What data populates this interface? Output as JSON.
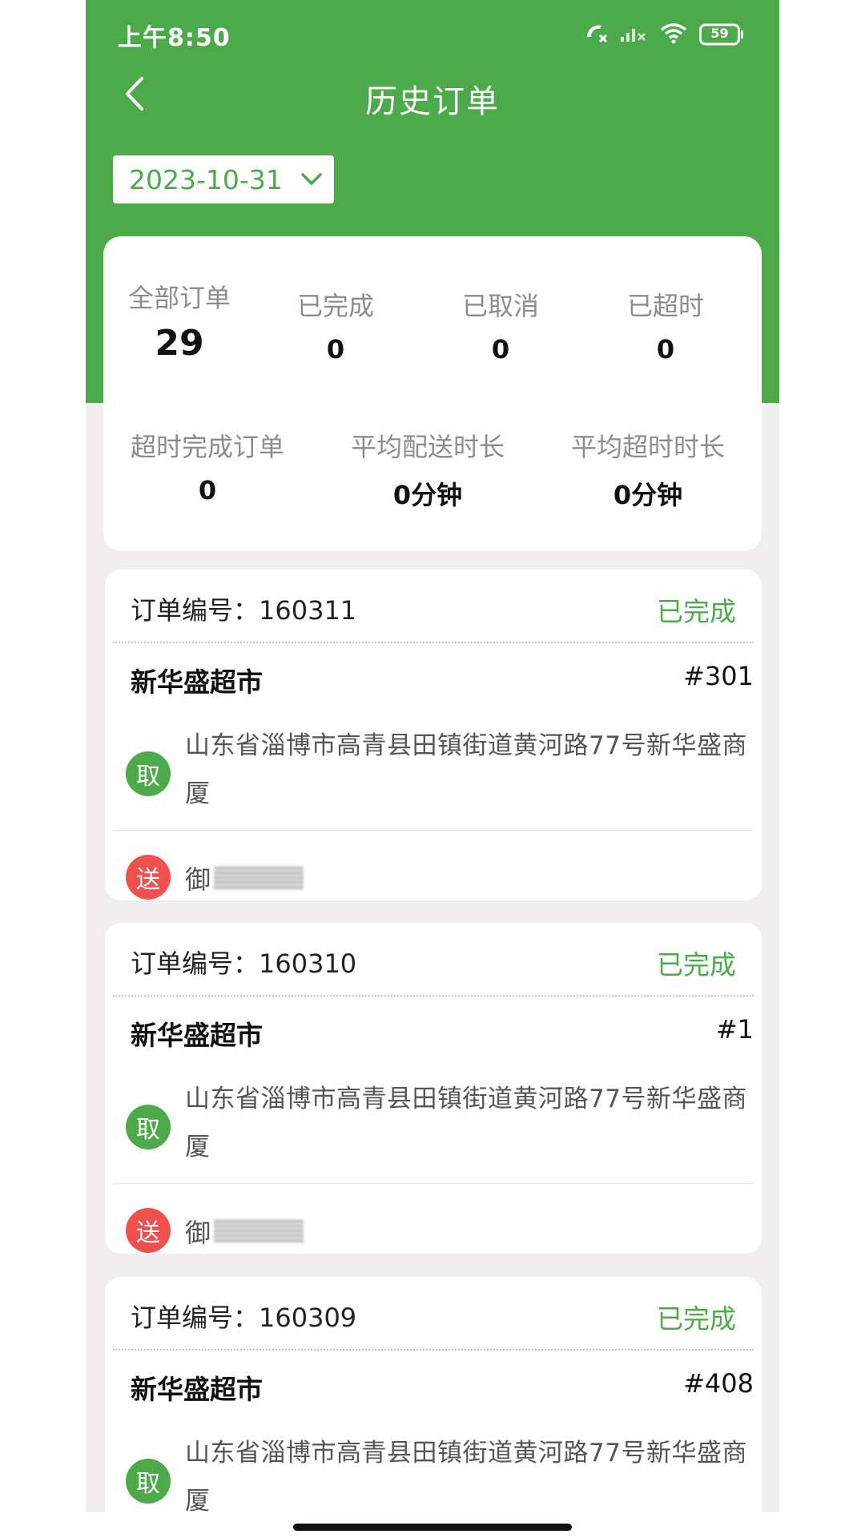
{
  "status_bar": {
    "time": "上午8:50",
    "battery": "59"
  },
  "header": {
    "title": "历史订单",
    "date": "2023-10-31"
  },
  "summary": {
    "row1": [
      {
        "label": "全部订单",
        "value": "29"
      },
      {
        "label": "已完成",
        "value": "0"
      },
      {
        "label": "已取消",
        "value": "0"
      },
      {
        "label": "已超时",
        "value": "0"
      }
    ],
    "row2": [
      {
        "label": "超时完成订单",
        "value": "0"
      },
      {
        "label": "平均配送时长",
        "value": "0分钟"
      },
      {
        "label": "平均超时时长",
        "value": "0分钟"
      }
    ]
  },
  "orders": [
    {
      "number_label": "订单编号：160311",
      "status": "已完成",
      "shop": "新华盛超市",
      "tag": "#301",
      "pickup_badge": "取",
      "pickup_address": "山东省淄博市高青县田镇街道黄河路77号新华盛商厦",
      "deliver_badge": "送",
      "deliver_name": "御"
    },
    {
      "number_label": "订单编号：160310",
      "status": "已完成",
      "shop": "新华盛超市",
      "tag": "#1",
      "pickup_badge": "取",
      "pickup_address": "山东省淄博市高青县田镇街道黄河路77号新华盛商厦",
      "deliver_badge": "送",
      "deliver_name": "御"
    },
    {
      "number_label": "订单编号：160309",
      "status": "已完成",
      "shop": "新华盛超市",
      "tag": "#408",
      "pickup_badge": "取",
      "pickup_address": "山东省淄博市高青县田镇街道黄河路77号新华盛商厦"
    }
  ],
  "colors": {
    "brand_green": "#4caa4a",
    "deliver_red": "#f0504e"
  },
  "icons": [
    "back-arrow-icon",
    "chevron-down-icon",
    "call-missed-icon",
    "signal-icon",
    "wifi-icon",
    "battery-icon"
  ]
}
